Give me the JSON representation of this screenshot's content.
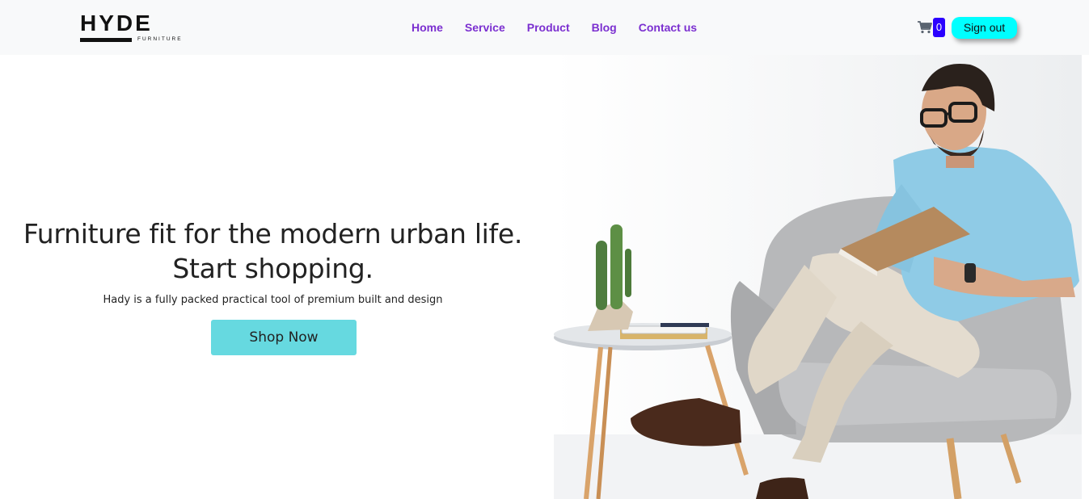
{
  "brand": {
    "name": "HYDE",
    "sub": "FURNITURE"
  },
  "nav": {
    "links": [
      "Home",
      "Service",
      "Product",
      "Blog",
      "Contact us"
    ],
    "cart_count": "0",
    "signout_label": "Sign out"
  },
  "hero": {
    "title_line1": "Furniture fit for the modern urban life.",
    "title_line2": "Start shopping.",
    "subtitle": "Hady is a fully packed practical tool of premium built and design",
    "cta_label": "Shop Now"
  },
  "colors": {
    "nav_link": "#7b2fd0",
    "signout_bg": "#00ffff",
    "cart_badge": "#2b00ff",
    "cta_bg": "#66d9e0"
  },
  "icons": {
    "cart": "shopping-cart-icon"
  }
}
